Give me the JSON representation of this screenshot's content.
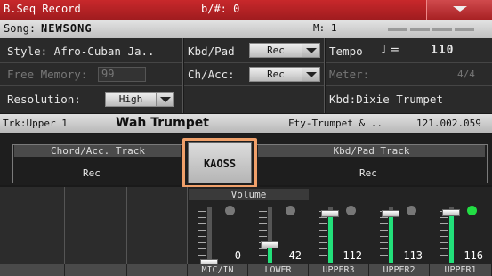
{
  "title": "B.Seq Record",
  "key_sig": "b/#: 0",
  "song": {
    "label": "Song:",
    "name": "NEWSONG",
    "measure": "M: 1"
  },
  "left": {
    "style": "Style: Afro-Cuban Ja..",
    "free_memory_label": "Free Memory:",
    "free_memory": "99",
    "resolution_label": "Resolution:",
    "resolution": "High"
  },
  "mid": {
    "kbd_pad_label": "Kbd/Pad",
    "kbd_pad_value": "Rec",
    "ch_acc_label": "Ch/Acc:",
    "ch_acc_value": "Rec"
  },
  "right": {
    "tempo_label": "Tempo",
    "tempo_symbol": "♩ =",
    "tempo_value": "110",
    "meter_label": "Meter:",
    "meter_value": "4/4",
    "kbd_sound": "Kbd:Dixie Trumpet"
  },
  "track": {
    "label": "Trk:Upper 1",
    "sound": "Wah Trumpet",
    "factory": "Fty-Trumpet & ..",
    "code": "121.002.059"
  },
  "chord_track": {
    "title": "Chord/Acc. Track",
    "value": "Rec"
  },
  "kbd_track": {
    "title": "Kbd/Pad Track",
    "value": "Rec"
  },
  "kaoss_label": "KAOSS",
  "volume_label": "Volume",
  "channels": [
    {
      "name": "MIC/IN",
      "value": "0",
      "level": 0.0,
      "led": "#777777"
    },
    {
      "name": "LOWER",
      "value": "42",
      "level": 0.33,
      "led": "#777777"
    },
    {
      "name": "UPPER3",
      "value": "112",
      "level": 0.88,
      "led": "#777777"
    },
    {
      "name": "UPPER2",
      "value": "113",
      "level": 0.89,
      "led": "#777777"
    },
    {
      "name": "UPPER1",
      "value": "116",
      "level": 0.91,
      "led": "#22dd44"
    }
  ],
  "colors": {
    "accent": "#c8282b",
    "meter": "#22e07a",
    "highlight": "#f0a06a"
  }
}
